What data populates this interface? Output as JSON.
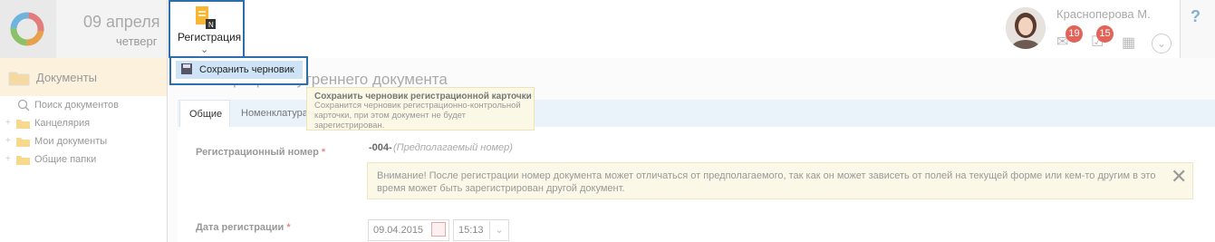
{
  "header": {
    "date_day": "09 апреля",
    "date_weekday": "четверг",
    "register_label": "Регистрация",
    "user_name": "Красноперова М.",
    "badges": {
      "mail": "19",
      "tasks": "15"
    },
    "help": "?"
  },
  "menu": {
    "save_draft": "Сохранить черновик"
  },
  "tooltip": {
    "title": "Сохранить черновик регистрационной карточки",
    "body": "Сохранится черновик регистрационно-контрольной карточки, при этом документ не будет зарегистрирован."
  },
  "sidebar": {
    "title": "Документы",
    "items": [
      {
        "label": "Поиск документов",
        "icon": "search-icon"
      },
      {
        "label": "Канцелярия",
        "icon": "folder-icon"
      },
      {
        "label": "Мои документы",
        "icon": "folder-icon"
      },
      {
        "label": "Общие папки",
        "icon": "folder-icon"
      }
    ]
  },
  "form": {
    "title": "Регистрация внутреннего документа",
    "tabs": [
      "Общие",
      "Номенклатура"
    ],
    "reg_number_label": "Регистрационный номер",
    "reg_number_value": "-004-",
    "reg_number_hint": "(Предполагаемый номер)",
    "warning": "Внимание! После регистрации номер документа может отличаться от предполагаемого, так как он может зависеть от полей на текущей форме или кем-то другим в это время может быть зарегистрирован другой документ.",
    "reg_date_label": "Дата регистрации",
    "reg_date_value": "09.04.2015",
    "reg_time_value": "15:13",
    "required_mark": "*"
  },
  "colors": {
    "accent_border": "#2d6fad",
    "menu_highlight": "#cfe3f7",
    "badge": "#e0645a"
  }
}
